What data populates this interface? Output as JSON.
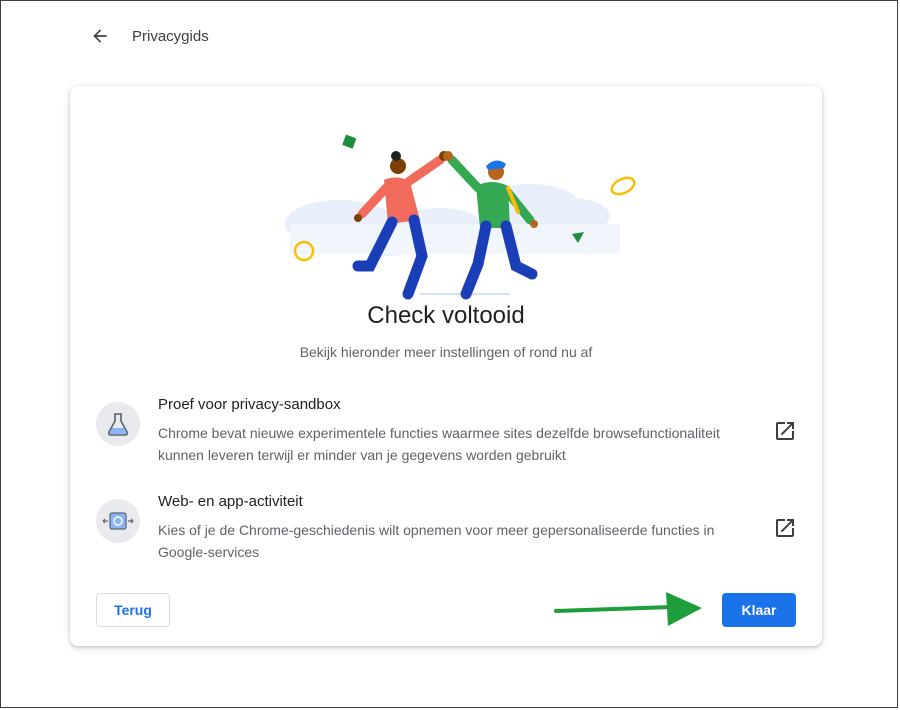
{
  "header": {
    "title": "Privacygids",
    "back_icon": "arrow-left-icon"
  },
  "card": {
    "heading": "Check voltooid",
    "subtitle": "Bekijk hieronder meer instellingen of rond nu af",
    "items": [
      {
        "title": "Proef voor privacy-sandbox",
        "description": "Chrome bevat nieuwe experimentele functies waarmee sites dezelfde browsefunctionaliteit kunnen leveren terwijl er minder van je gegevens worden gebruikt",
        "icon": "flask-icon",
        "link_icon": "open-in-new-icon"
      },
      {
        "title": "Web- en app-activiteit",
        "description": "Kies of je de Chrome-geschiedenis wilt opnemen voor meer gepersonaliseerde functies in Google-services",
        "icon": "sync-browser-icon",
        "link_icon": "open-in-new-icon"
      }
    ],
    "back_button": "Terug",
    "done_button": "Klaar"
  },
  "colors": {
    "accent": "#1a73e8",
    "annotation_arrow": "#1e9e3a",
    "text_primary": "#202124",
    "text_secondary": "#5f6368"
  }
}
